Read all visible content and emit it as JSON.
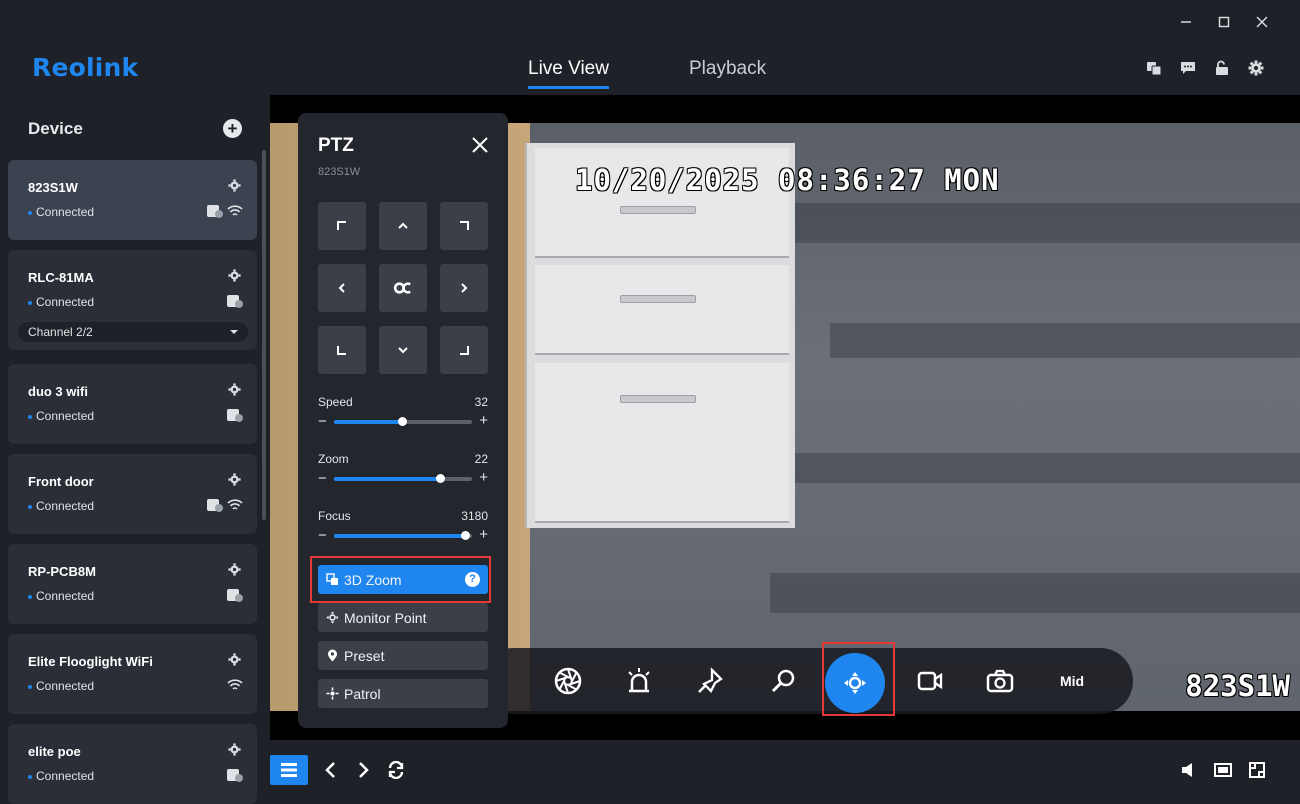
{
  "window": {
    "controls": [
      "minimize-icon",
      "maximize-icon",
      "close-icon"
    ]
  },
  "header": {
    "logo": "Reolink",
    "tabs": [
      {
        "label": "Live View",
        "active": true
      },
      {
        "label": "Playback",
        "active": false
      }
    ],
    "icons": [
      "translate-icon",
      "message-icon",
      "unlock-icon",
      "gear-icon"
    ]
  },
  "sidebar": {
    "title": "Device",
    "devices": [
      {
        "name": "823S1W",
        "status": "Connected",
        "selected": true,
        "icons": [
          "battery-icon",
          "wifi-icon"
        ]
      },
      {
        "name": "RLC-81MA",
        "status": "Connected",
        "channel": "Channel 2/2",
        "icons": [
          "battery-icon"
        ]
      },
      {
        "name": "duo 3 wifi",
        "status": "Connected",
        "icons": [
          "battery-icon"
        ]
      },
      {
        "name": "Front door",
        "status": "Connected",
        "icons": [
          "battery-icon",
          "wifi-icon"
        ]
      },
      {
        "name": "RP-PCB8M",
        "status": "Connected",
        "icons": [
          "battery-icon"
        ]
      },
      {
        "name": "Elite Flooglight WiFi",
        "status": "Connected",
        "icons": [
          "wifi-icon"
        ]
      },
      {
        "name": "elite poe",
        "status": "Connected",
        "icons": [
          "battery-icon"
        ]
      }
    ]
  },
  "video": {
    "timestamp": "10/20/2025 08:36:27 MON",
    "camera_label": "823S1W",
    "controls": [
      "aperture-icon",
      "siren-icon",
      "spotlight-icon",
      "search-zoom-icon",
      "ptz-icon",
      "record-icon",
      "snapshot-icon"
    ],
    "active_control": "ptz-icon",
    "stream_label": "Mid"
  },
  "ptz": {
    "title": "PTZ",
    "device": "823S1W",
    "speed": {
      "label": "Speed",
      "value": "32",
      "fraction": 0.49
    },
    "zoom": {
      "label": "Zoom",
      "value": "22",
      "fraction": 0.77
    },
    "focus": {
      "label": "Focus",
      "value": "3180",
      "fraction": 0.95
    },
    "items": [
      {
        "label": "3D Zoom",
        "active": true,
        "help": "?"
      },
      {
        "label": "Monitor Point",
        "active": false
      },
      {
        "label": "Preset",
        "active": false
      },
      {
        "label": "Patrol",
        "active": false
      }
    ]
  },
  "bottom": {
    "left_icons": [
      "layout-icon",
      "prev-icon",
      "next-icon",
      "refresh-icon"
    ],
    "right_icons": [
      "volume-icon",
      "aspect-icon",
      "fullscreen-icon"
    ]
  },
  "colors": {
    "accent": "#1f86ef",
    "highlight": "#e53935",
    "background": "#1e2127",
    "card": "#2a2e36"
  }
}
